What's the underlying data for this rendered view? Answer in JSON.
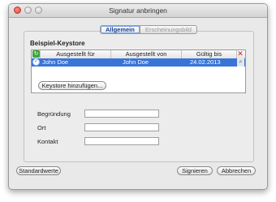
{
  "window": {
    "title": "Signatur anbringen"
  },
  "tabs": [
    {
      "label": "Allgemein"
    },
    {
      "label": "Erscheinungsbild"
    }
  ],
  "section": {
    "title": "Beispiel-Keystore"
  },
  "table": {
    "columns": [
      "Ausgestellt für",
      "Ausgestellt von",
      "Gültig bis"
    ],
    "rows": [
      {
        "issued_to": "John Doe",
        "issued_by": "John Doe",
        "valid_until": "24.02.2013"
      }
    ]
  },
  "buttons": {
    "add_keystore": "Keystore hinzufügen...",
    "defaults": "Standardwerte",
    "sign": "Signieren",
    "cancel": "Abbrechen"
  },
  "fields": [
    {
      "label": "Begründung",
      "value": ""
    },
    {
      "label": "Ort",
      "value": ""
    },
    {
      "label": "Kontakt",
      "value": ""
    }
  ],
  "icons": {
    "refresh": "refresh-icon",
    "delete": "delete-icon",
    "certificate": "certificate-icon",
    "search": "search-icon"
  },
  "colors": {
    "selection": "#3875d7",
    "delete": "#d02010",
    "refresh": "#3fa33a"
  }
}
